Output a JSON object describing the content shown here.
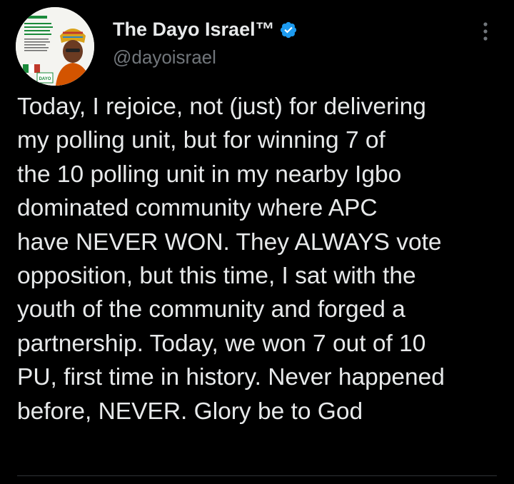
{
  "tweet": {
    "author": {
      "display_name": "The Dayo Israel™",
      "handle": "@dayoisrael",
      "verified": true,
      "avatar_icon": "profile-photo-avatar",
      "avatar_text": "DAYO ISRAEL"
    },
    "text_lines": [
      "Today, I rejoice, not (just) for delivering",
      "my polling unit, but for winning 7 of",
      "the 10 polling unit in my nearby Igbo",
      "dominated community where APC",
      "have NEVER WON. They ALWAYS vote",
      "opposition, but this time, I sat with the",
      "youth of the community and forged a",
      "partnership. Today, we won 7 out of 10",
      "PU, first time in history. Never happened",
      "before, NEVER. Glory be to God"
    ],
    "more_icon": "more-vertical-icon"
  },
  "colors": {
    "background": "#000000",
    "text": "#e7e9ea",
    "secondary_text": "#71767b",
    "verified_blue": "#1d9bf0",
    "divider": "#2f3336"
  }
}
